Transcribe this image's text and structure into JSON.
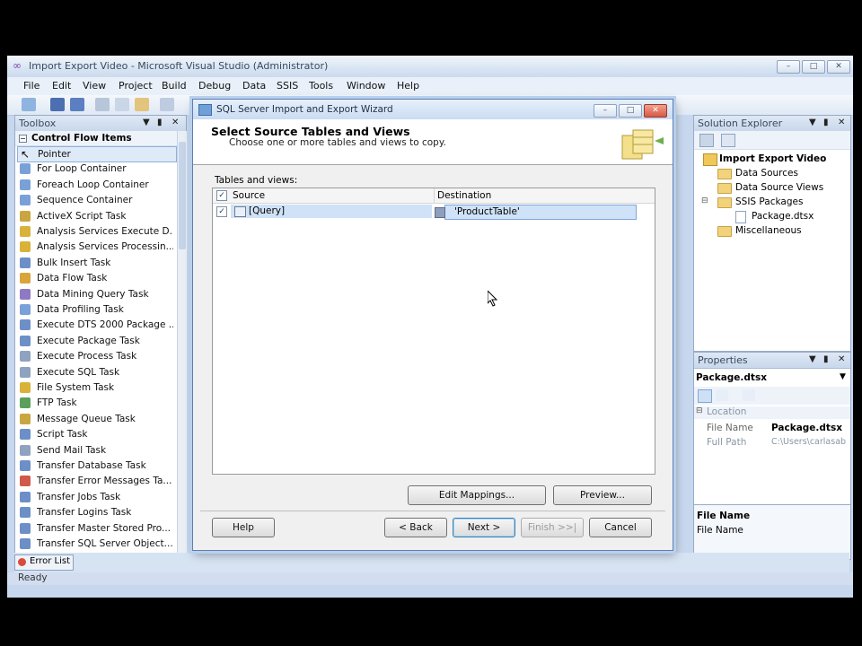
{
  "window": {
    "title": "Import Export Video - Microsoft Visual Studio (Administrator)",
    "caption_buttons": [
      "–",
      "□",
      "✕"
    ]
  },
  "menu": [
    "File",
    "Edit",
    "View",
    "Project",
    "Build",
    "Debug",
    "Data",
    "SSIS",
    "Tools",
    "Window",
    "Help"
  ],
  "toolbox": {
    "title": "Toolbox",
    "group": "Control Flow Items",
    "items": [
      "Pointer",
      "For Loop Container",
      "Foreach Loop Container",
      "Sequence Container",
      "ActiveX Script Task",
      "Analysis Services Execute D...",
      "Analysis Services Processin...",
      "Bulk Insert Task",
      "Data Flow Task",
      "Data Mining Query Task",
      "Data Profiling Task",
      "Execute DTS 2000 Package ...",
      "Execute Package Task",
      "Execute Process Task",
      "Execute SQL Task",
      "File System Task",
      "FTP Task",
      "Message Queue Task",
      "Script Task",
      "Send Mail Task",
      "Transfer Database Task",
      "Transfer Error Messages Ta...",
      "Transfer Jobs Task",
      "Transfer Logins Task",
      "Transfer Master Stored Pro...",
      "Transfer SQL Server Object..."
    ]
  },
  "solution_explorer": {
    "title": "Solution Explorer",
    "root": "Import Export Video",
    "items": [
      "Data Sources",
      "Data Source Views",
      "SSIS Packages",
      "Package.dtsx",
      "Miscellaneous"
    ]
  },
  "properties": {
    "title": "Properties",
    "object": "Package.dtsx",
    "category": "Location",
    "rows": [
      {
        "name": "File Name",
        "value": "Package.dtsx"
      },
      {
        "name": "Full Path",
        "value": "C:\\Users\\carlasab"
      }
    ],
    "desc_title": "File Name",
    "desc_text": "File Name"
  },
  "error_list_tab": "Error List",
  "status": "Ready",
  "dialog": {
    "title": "SQL Server Import and Export Wizard",
    "heading": "Select Source Tables and Views",
    "subheading": "Choose one or more tables and views to copy.",
    "tables_label": "Tables and views:",
    "col_source": "Source",
    "col_destination": "Destination",
    "rows": [
      {
        "source": "[Query]",
        "destination": "'ProductTable'",
        "checked": true
      }
    ],
    "buttons": {
      "edit_mappings": "Edit Mappings...",
      "preview": "Preview...",
      "help": "Help",
      "back": "< Back",
      "next": "Next >",
      "finish": "Finish >>|",
      "cancel": "Cancel"
    }
  },
  "colors": {
    "vs_background": "#c7d8ee",
    "selection": "#cfe2f7",
    "dialog_border": "#5c7eb3"
  }
}
